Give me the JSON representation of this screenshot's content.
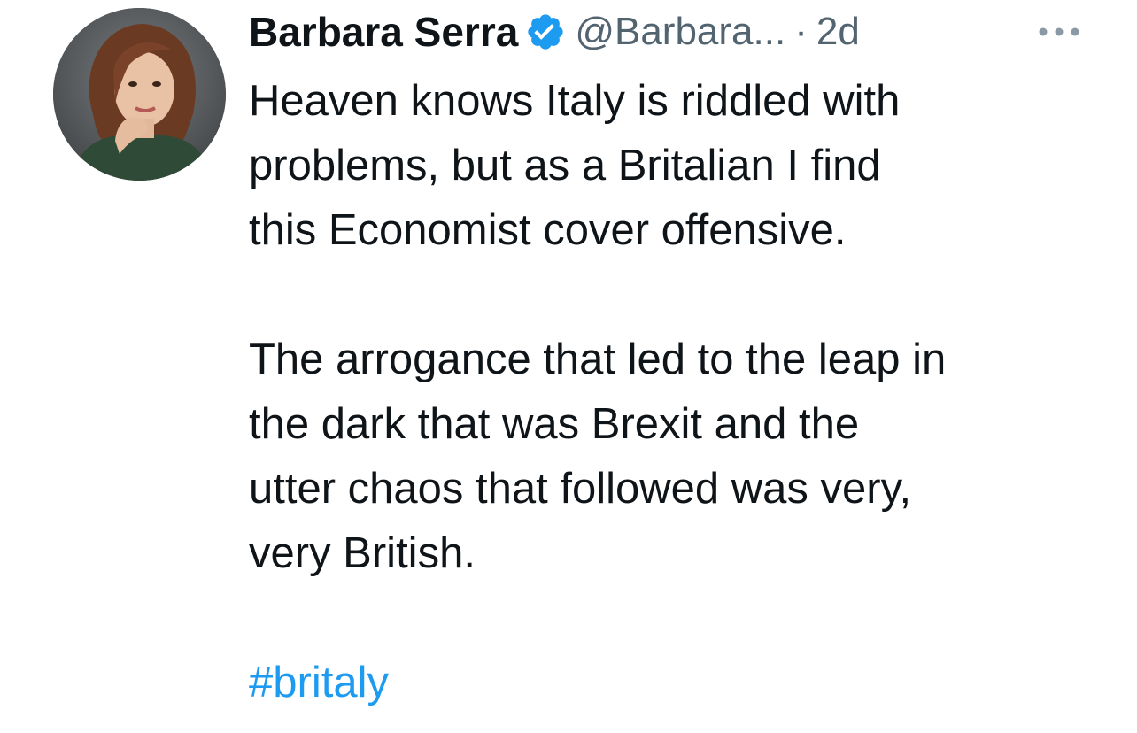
{
  "tweet": {
    "author": {
      "display_name": "Barbara Serra",
      "handle": "@Barbara...",
      "verified": true,
      "avatar_icon": "avatar-photo"
    },
    "separator": "·",
    "timestamp": "2d",
    "more_icon": "more-horizontal-icon",
    "body": {
      "lines_paragraph_1": [
        "Heaven knows Italy is riddled with",
        "problems, but as a Britalian I find",
        "this Economist cover offensive."
      ],
      "lines_paragraph_2": [
        "The arrogance that led to the leap in",
        "the dark that was Brexit and the",
        "utter chaos that followed was very,",
        "very British."
      ],
      "hashtag": "#britaly"
    }
  },
  "colors": {
    "text_primary": "#0f1419",
    "text_secondary": "#536471",
    "accent": "#1d9bf0"
  }
}
